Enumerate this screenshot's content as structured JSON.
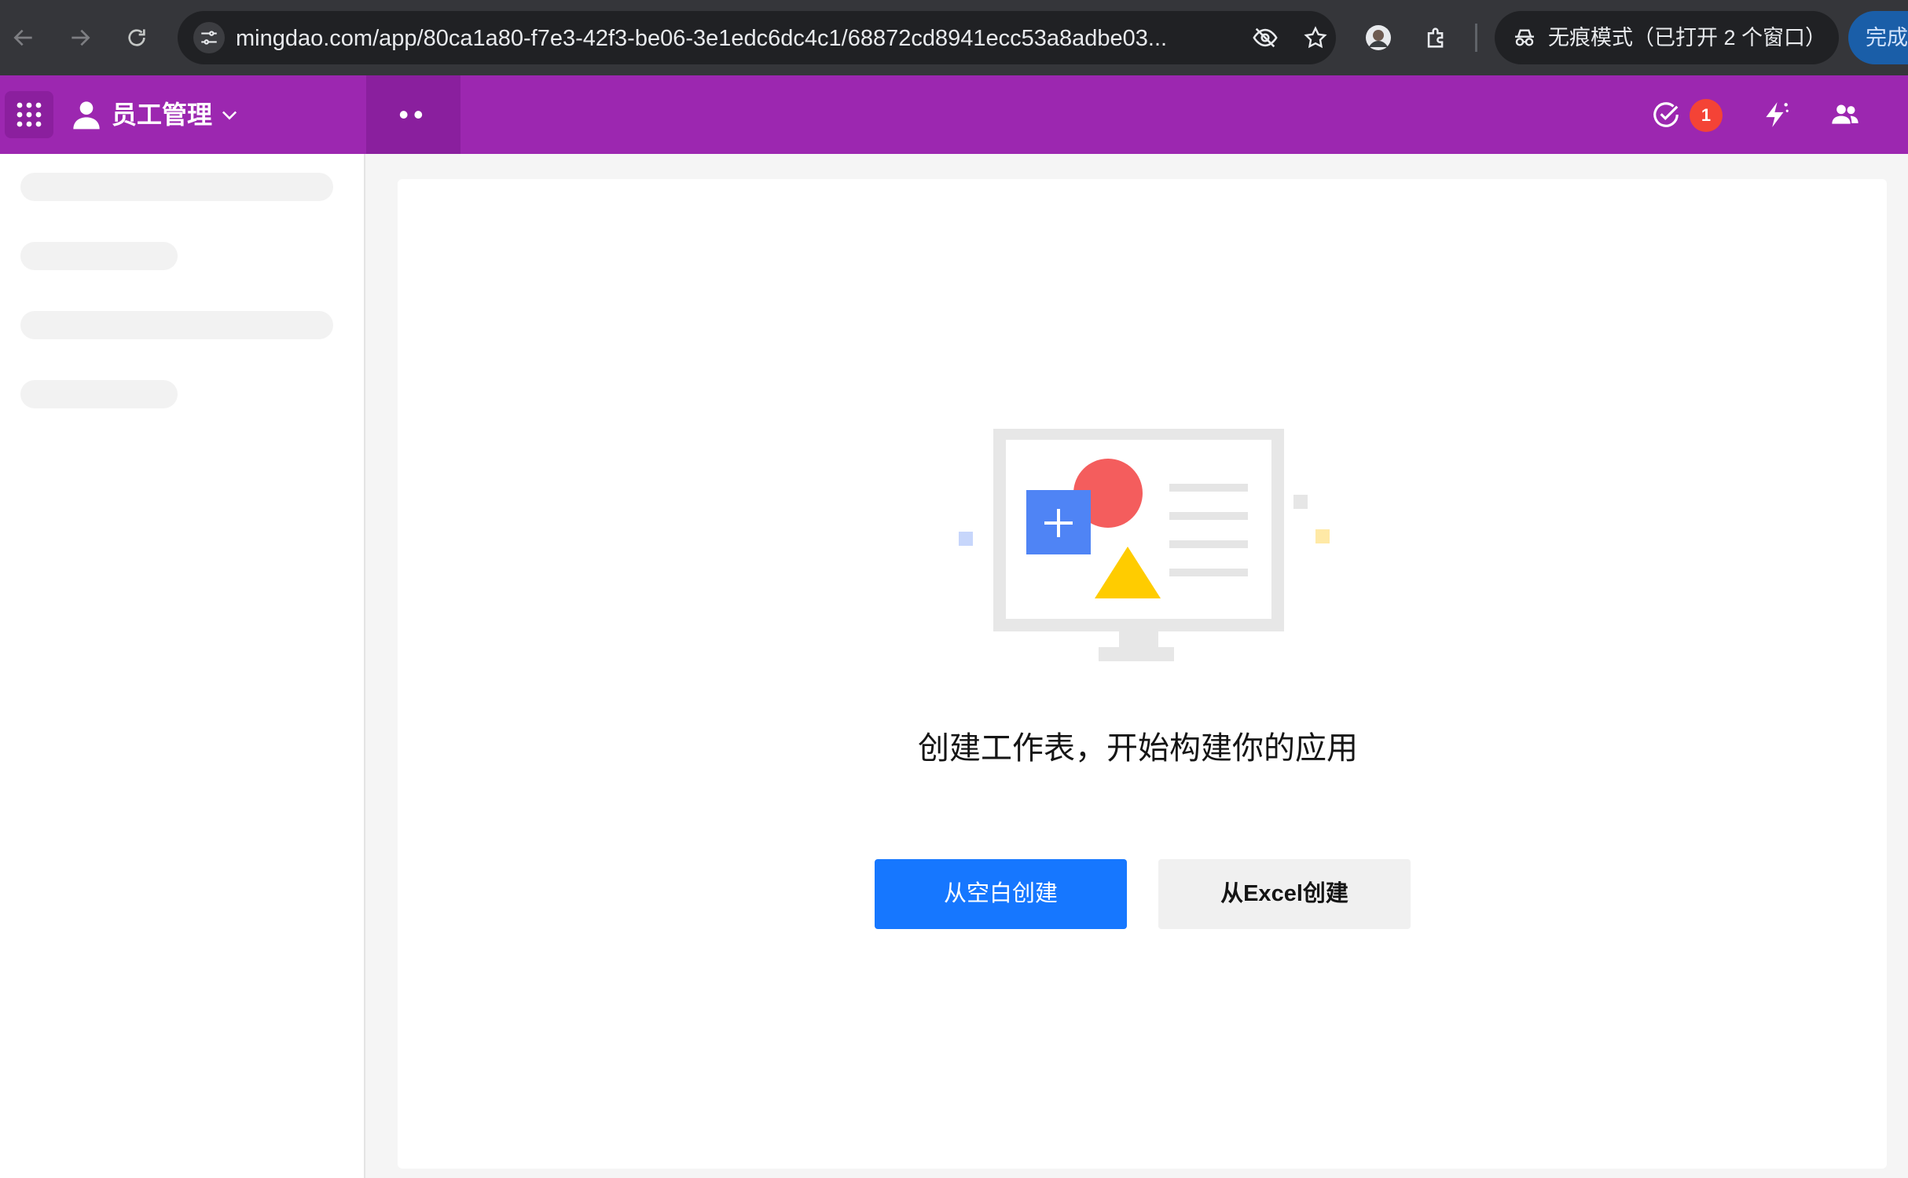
{
  "browser": {
    "url": "mingdao.com/app/80ca1a80-f7e3-42f3-be06-3e1edc6dc4c1/68872cd8941ecc53a8adbe03...",
    "incognito_label": "无痕模式（已打开 2 个窗口）",
    "finish_label": "完成",
    "icons": [
      "back-arrow-icon",
      "forward-arrow-icon",
      "reload-icon",
      "site-settings-icon",
      "eye-off-icon",
      "star-icon",
      "profile-avatar-icon",
      "extensions-icon",
      "incognito-icon"
    ]
  },
  "app_header": {
    "app_name": "员工管理",
    "nav_dots": "••",
    "todo_badge_count": "1",
    "accent_color": "#9c27b0",
    "icons": [
      "apps-grid-icon",
      "person-icon",
      "chevron-down-icon",
      "check-circle-icon",
      "lightning-icon",
      "group-icon"
    ]
  },
  "main": {
    "empty_message": "创建工作表，开始构建你的应用",
    "create_blank_label": "从空白创建",
    "create_excel_label": "从Excel创建",
    "primary_color": "#1677ff"
  }
}
